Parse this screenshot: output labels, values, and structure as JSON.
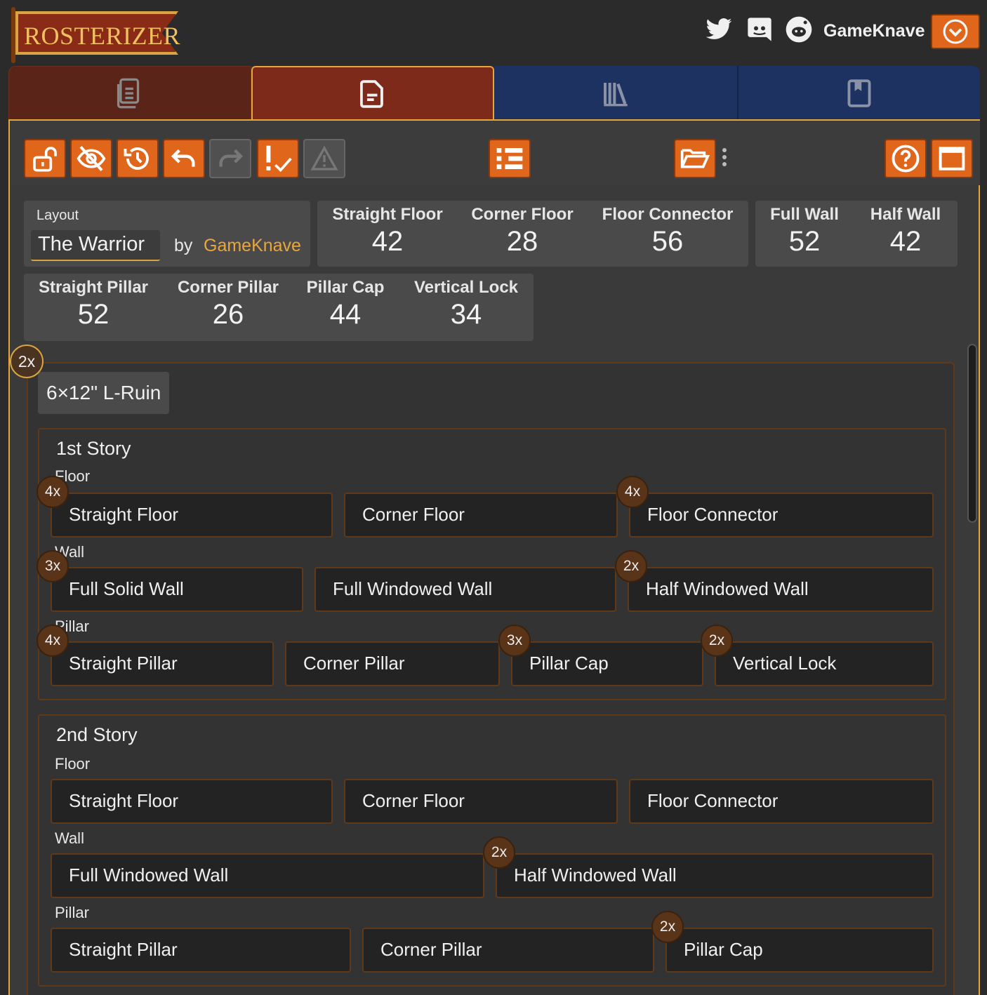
{
  "app": {
    "logo_text": "ROSTERIZER"
  },
  "header": {
    "username": "GameKnave",
    "social_icons": [
      "twitter-icon",
      "discord-icon",
      "reddit-icon"
    ]
  },
  "tabs": [
    "documents-icon",
    "document-icon",
    "library-icon",
    "bookmark-icon"
  ],
  "toolbar": {
    "left": [
      "unlock-icon",
      "hide-icon",
      "history-icon",
      "undo-icon",
      "redo-icon",
      "validate-icon",
      "warning-icon"
    ],
    "center": "list-icon",
    "right": [
      "folder-open-icon",
      "help-icon",
      "maximize-icon"
    ]
  },
  "layout": {
    "label": "Layout",
    "name": "The Warrior",
    "by": "by",
    "author": "GameKnave"
  },
  "stats": {
    "floors": [
      {
        "label": "Straight Floor",
        "value": "42"
      },
      {
        "label": "Corner Floor",
        "value": "28"
      },
      {
        "label": "Floor Connector",
        "value": "56"
      }
    ],
    "walls": [
      {
        "label": "Full Wall",
        "value": "52"
      },
      {
        "label": "Half Wall",
        "value": "42"
      }
    ],
    "pillars": [
      {
        "label": "Straight Pillar",
        "value": "52"
      },
      {
        "label": "Corner Pillar",
        "value": "26"
      },
      {
        "label": "Pillar Cap",
        "value": "44"
      },
      {
        "label": "Vertical Lock",
        "value": "34"
      }
    ]
  },
  "section": {
    "count": "2x",
    "title": "6×12\" L-Ruin",
    "stories": [
      {
        "title": "1st Story",
        "floor_label": "Floor",
        "floor": [
          {
            "name": "Straight Floor",
            "count": "4x"
          },
          {
            "name": "Corner Floor",
            "count": ""
          },
          {
            "name": "Floor Connector",
            "count": "4x"
          }
        ],
        "wall_label": "Wall",
        "wall": [
          {
            "name": "Full Solid Wall",
            "count": "3x"
          },
          {
            "name": "Full Windowed Wall",
            "count": ""
          },
          {
            "name": "Half Windowed Wall",
            "count": "2x"
          }
        ],
        "pillar_label": "Pillar",
        "pillar": [
          {
            "name": "Straight Pillar",
            "count": "4x"
          },
          {
            "name": "Corner Pillar",
            "count": ""
          },
          {
            "name": "Pillar Cap",
            "count": "3x"
          },
          {
            "name": "Vertical Lock",
            "count": "2x"
          }
        ]
      },
      {
        "title": "2nd Story",
        "floor_label": "Floor",
        "floor": [
          {
            "name": "Straight Floor",
            "count": ""
          },
          {
            "name": "Corner Floor",
            "count": ""
          },
          {
            "name": "Floor Connector",
            "count": ""
          }
        ],
        "wall_label": "Wall",
        "wall": [
          {
            "name": "Full Windowed Wall",
            "count": ""
          },
          {
            "name": "Half Windowed Wall",
            "count": "2x"
          }
        ],
        "pillar_label": "Pillar",
        "pillar": [
          {
            "name": "Straight Pillar",
            "count": ""
          },
          {
            "name": "Corner Pillar",
            "count": ""
          },
          {
            "name": "Pillar Cap",
            "count": "2x"
          }
        ]
      }
    ]
  },
  "colors": {
    "accent": "#e0661c",
    "gold": "#d9a441",
    "tab_active": "#7e2a1a",
    "tab_blue": "#1d3260"
  }
}
